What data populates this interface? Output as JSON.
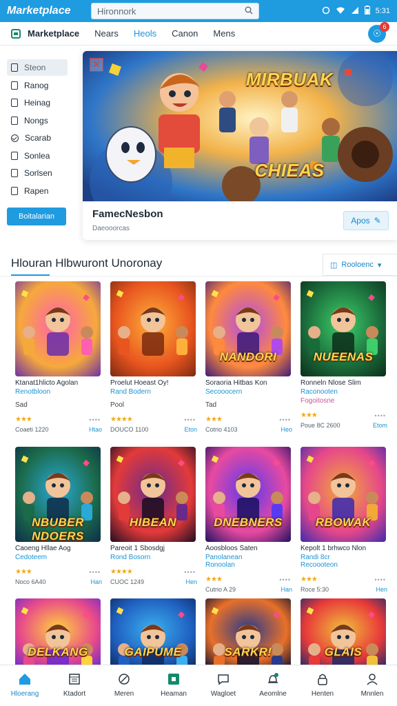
{
  "status_bar": {
    "brand": "Marketplace",
    "search_placeholder": "Hironnork",
    "time": "5:31"
  },
  "nav": {
    "title": "Marketplace",
    "links": [
      "Nears",
      "Heols",
      "Canon",
      "Mens"
    ],
    "active_index": 1,
    "badge": "6"
  },
  "sidebar": {
    "items": [
      {
        "label": "Steon",
        "selected": true,
        "icon": "file-icon"
      },
      {
        "label": "Ranog",
        "icon": "file-icon"
      },
      {
        "label": "Heinag",
        "icon": "file-icon"
      },
      {
        "label": "Nongs",
        "icon": "file-icon"
      },
      {
        "label": "Scarab",
        "icon": "check-circle-icon"
      },
      {
        "label": "Sonlea",
        "icon": "file-icon"
      },
      {
        "label": "Sorlsen",
        "icon": "file-icon"
      },
      {
        "label": "Rapen",
        "icon": "file-icon"
      }
    ],
    "button_label": "Boitalarian"
  },
  "hero": {
    "banner_text_top": "MIRBUAK",
    "banner_text_bottom": "CHIEAS",
    "title": "FamecNesbon",
    "subtitle": "Daeooorcas",
    "button_label": "Apos",
    "button_icon": "edit-icon"
  },
  "section": {
    "title": "Hlouran Hlbwuront Unoronay",
    "button_label": "Rooloenc"
  },
  "cards": [
    {
      "art": "PINK",
      "art_text": "",
      "title": "Ktanat1hlicto Agolan",
      "sub": "Renotbloon",
      "tag": "Sad",
      "rating": 3,
      "meta": "Coaeti 1220",
      "link": "Htao"
    },
    {
      "art": "ORANGE",
      "art_text": "",
      "title": "Proelut Hoeast Oy!",
      "sub": "Rand Bodern",
      "tag": "Pool",
      "rating": 4,
      "meta": "DOUCO 1100",
      "link": "Eton"
    },
    {
      "art": "PURPLE",
      "art_text": "NANDORI",
      "title": "Soraoria Hitbas Kon",
      "sub": "Secooocern",
      "tag": "Tad",
      "rating": 3,
      "meta": "Cotrio 4103",
      "link": "Heo"
    },
    {
      "art": "GREEN",
      "art_text": "NUEENAS",
      "title": "Ronneln Nlose Slim",
      "sub": "Raconooten",
      "tag": "Fogoitosne",
      "tag_pink": true,
      "rating": 3,
      "meta": "Poue 8C 2600",
      "link": "Etom"
    },
    {
      "art": "TEAL",
      "art_text": "NBUBER NDOERS",
      "title": "Caoeng Hllae Aog",
      "sub": "Cedoteem",
      "tag": "",
      "rating": 3,
      "meta": "Noco 6A40",
      "link": "Han"
    },
    {
      "art": "DARK",
      "art_text": "HIBEAN",
      "title": "Pareoit 1 Sbosdgj",
      "sub": "Rond Bosorn",
      "tag": "",
      "rating": 4,
      "meta": "CUOC 1249",
      "link": "Hen"
    },
    {
      "art": "VIOLET",
      "art_text": "DNEBNERS",
      "title": "Aoosbloos Saten",
      "sub": "Panolanean",
      "sub2": "Ronoolan",
      "tag": "",
      "rating": 3,
      "meta": "Cutrio A 29",
      "link": "Han"
    },
    {
      "art": "SUNSET",
      "art_text": "RBOWAK",
      "title": "Kepolt 1 brhwco Nlon",
      "sub": "Randi 8cr",
      "sub2": "Recoooteon",
      "tag": "",
      "rating": 3,
      "meta": "Roce 5:30",
      "link": "Hen"
    },
    {
      "art": "YELLOW",
      "art_text": "DELKANG",
      "title": "",
      "sub": "",
      "tag": "",
      "rating": 0,
      "meta": "",
      "link": ""
    },
    {
      "art": "BLUE",
      "art_text": "GAIPUME",
      "title": "",
      "sub": "",
      "tag": "",
      "rating": 0,
      "meta": "",
      "link": ""
    },
    {
      "art": "NAVY",
      "art_text": "SARKR!",
      "title": "",
      "sub": "",
      "tag": "",
      "rating": 0,
      "meta": "",
      "link": ""
    },
    {
      "art": "RED",
      "art_text": "GLAIS",
      "title": "",
      "sub": "",
      "tag": "",
      "rating": 0,
      "meta": "",
      "link": ""
    }
  ],
  "tabs": [
    {
      "label": "Hloerang",
      "icon": "home-icon",
      "active": true
    },
    {
      "label": "Ktadort",
      "icon": "calendar-icon"
    },
    {
      "label": "Meren",
      "icon": "pen-icon"
    },
    {
      "label": "Heaman",
      "icon": "store-icon",
      "highlight": true
    },
    {
      "label": "Wagloet",
      "icon": "chat-icon"
    },
    {
      "label": "Aeomlne",
      "icon": "bell-icon"
    },
    {
      "label": "Henten",
      "icon": "lock-icon"
    },
    {
      "label": "Mnnlen",
      "icon": "user-icon"
    }
  ],
  "colors": {
    "brand": "#1f9be0",
    "accent": "#1a93d4",
    "star": "#f3a712",
    "danger": "#e53935",
    "green": "#138a6b"
  }
}
